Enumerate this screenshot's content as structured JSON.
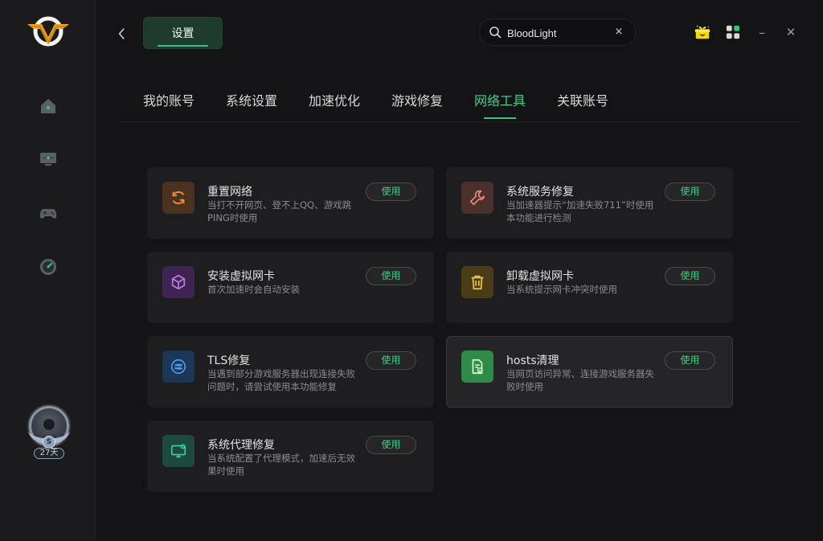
{
  "window": {
    "page_title": "设置"
  },
  "search": {
    "value": "BloodLight",
    "clear_glyph": "×"
  },
  "topbar": {
    "gift_icon": "gift-box-icon",
    "apps_icon": "grid-icon",
    "minimize_glyph": "–",
    "close_glyph": "✕"
  },
  "sidebar": {
    "items": [
      {
        "name": "home",
        "icon": "home-icon"
      },
      {
        "name": "accelerator",
        "icon": "monitor-icon"
      },
      {
        "name": "games",
        "icon": "gamepad-icon"
      },
      {
        "name": "speed",
        "icon": "speedometer-icon"
      }
    ],
    "profile": {
      "vip_mark": "S",
      "days_left": "27天"
    }
  },
  "tabs": [
    {
      "label": "我的账号"
    },
    {
      "label": "系统设置"
    },
    {
      "label": "加速优化"
    },
    {
      "label": "游戏修复"
    },
    {
      "label": "网络工具",
      "active": true
    },
    {
      "label": "关联账号"
    }
  ],
  "tools": [
    {
      "title": "重置网络",
      "desc": "当打不开网页、登不上QQ、游戏跳PING时使用",
      "button": "使用",
      "color": "#e67e22",
      "icon": "refresh-icon"
    },
    {
      "title": "系统服务修复",
      "desc": "当加速器提示“加速失败711”时使用本功能进行检测",
      "button": "使用",
      "color": "#d9766a",
      "icon": "wrench-icon"
    },
    {
      "title": "安装虚拟网卡",
      "desc": "首次加速时会自动安装",
      "button": "使用",
      "color": "#b46ad8",
      "icon": "cube-icon"
    },
    {
      "title": "卸载虚拟网卡",
      "desc": "当系统提示网卡冲突时使用",
      "button": "使用",
      "color": "#e0b63a",
      "icon": "trash-icon"
    },
    {
      "title": "TLS修复",
      "desc": "当遇到部分游戏服务器出现连接失败问题时，请尝试使用本功能修复",
      "button": "使用",
      "color": "#3a8ee6",
      "icon": "tls-icon"
    },
    {
      "title": "hosts清理",
      "desc": "当网页访问异常、连接游戏服务器失败时使用",
      "button": "使用",
      "color": "#4cc46a",
      "icon": "file-clean-icon"
    },
    {
      "title": "系统代理修复",
      "desc": "当系统配置了代理模式，加速后无效果时使用",
      "button": "使用",
      "color": "#2fbf8f",
      "icon": "monitor-repair-icon"
    }
  ]
}
